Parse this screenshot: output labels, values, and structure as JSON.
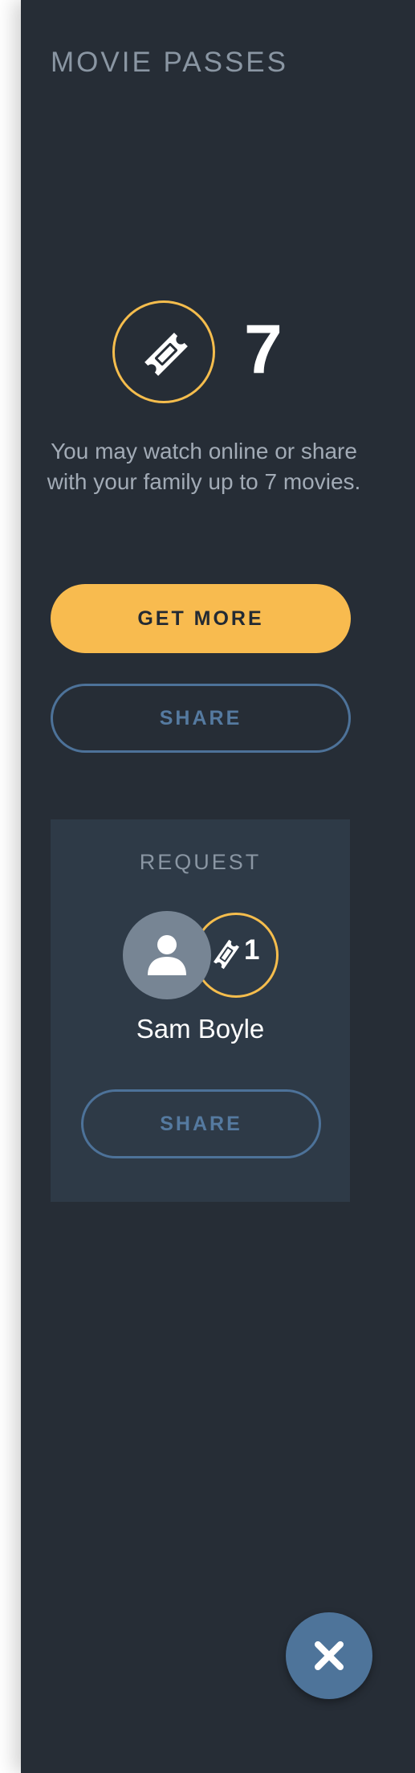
{
  "panel": {
    "title": "MOVIE PASSES"
  },
  "passes": {
    "count": "7",
    "icon": "ticket-icon",
    "description": "You may watch online or share with your family up to 7 movies."
  },
  "actions": {
    "get_more_label": "GET MORE",
    "share_label": "SHARE"
  },
  "request": {
    "label": "REQUEST",
    "name": "Sam Boyle",
    "ticket_count": "1",
    "avatar_icon": "user-icon",
    "share_label": "SHARE"
  },
  "close": {
    "icon": "close-icon"
  },
  "colors": {
    "panel_bg": "#262d36",
    "card_bg": "#2e3a47",
    "accent_yellow": "#f8bb4f",
    "accent_blue": "#4e749a",
    "muted_text": "#8a96a3"
  }
}
